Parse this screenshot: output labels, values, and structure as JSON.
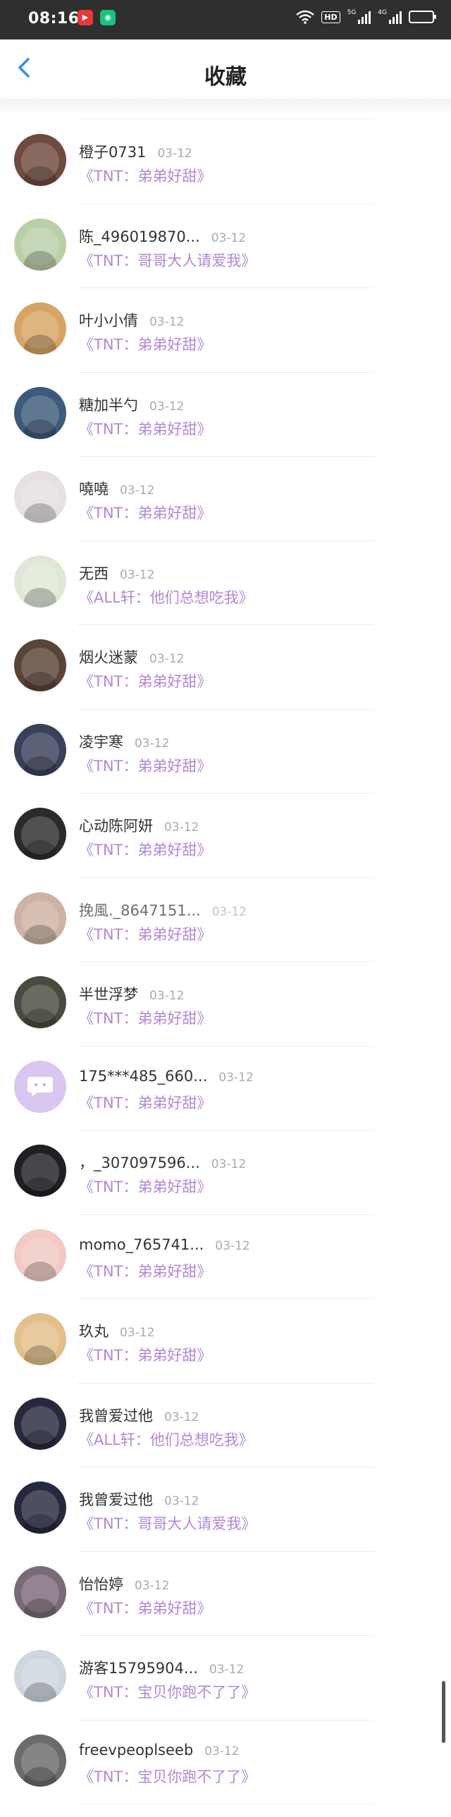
{
  "status_bar": {
    "time": "08:16",
    "hd_label": "HD",
    "signal1_label": "5G",
    "signal2_label": "4G"
  },
  "header": {
    "title": "收藏"
  },
  "colors": {
    "accent_blue": "#2f8fe6",
    "book_title": "#b287d9"
  },
  "items": [
    {
      "name": "橙子0731",
      "date": "03-12",
      "book": "《TNT：弟弟好甜》",
      "avatar_color": "#6f4a3e"
    },
    {
      "name": "陈_496019870...",
      "date": "03-12",
      "book": "《TNT：哥哥大人请爱我》",
      "avatar_color": "#b9cfa7"
    },
    {
      "name": "叶小小倩",
      "date": "03-12",
      "book": "《TNT：弟弟好甜》",
      "avatar_color": "#d7a465"
    },
    {
      "name": "糖加半勺",
      "date": "03-12",
      "book": "《TNT：弟弟好甜》",
      "avatar_color": "#3d5a7a"
    },
    {
      "name": "嘵嘵",
      "date": "03-12",
      "book": "《TNT：弟弟好甜》",
      "avatar_color": "#e6e0e0"
    },
    {
      "name": "无西",
      "date": "03-12",
      "book": "《ALL轩：他们总想吃我》",
      "avatar_color": "#dfe8d6"
    },
    {
      "name": "烟火迷蒙",
      "date": "03-12",
      "book": "《TNT：弟弟好甜》",
      "avatar_color": "#5a4438"
    },
    {
      "name": "凌宇寒",
      "date": "03-12",
      "book": "《TNT：弟弟好甜》",
      "avatar_color": "#3a3f5a"
    },
    {
      "name": "心动陈阿妍",
      "date": "03-12",
      "book": "《TNT：弟弟好甜》",
      "avatar_color": "#2b2b2b"
    },
    {
      "name": "挽風._8647151...",
      "date": "03-12",
      "book": "《TNT：弟弟好甜》",
      "avatar_color": "#cdb3a3"
    },
    {
      "name": "半世浮梦",
      "date": "03-12",
      "book": "《TNT：弟弟好甜》",
      "avatar_color": "#4b4a3e"
    },
    {
      "name": "175***485_660...",
      "date": "03-12",
      "book": "《TNT：弟弟好甜》",
      "avatar_color": "#d9c7f2"
    },
    {
      "name": "，_307097596...",
      "date": "03-12",
      "book": "《TNT：弟弟好甜》",
      "avatar_color": "#1f1f24"
    },
    {
      "name": "momo_765741...",
      "date": "03-12",
      "book": "《TNT：弟弟好甜》",
      "avatar_color": "#f2c9c4"
    },
    {
      "name": "玖丸",
      "date": "03-12",
      "book": "《TNT：弟弟好甜》",
      "avatar_color": "#e2c08a"
    },
    {
      "name": "我曾爱过他",
      "date": "03-12",
      "book": "《ALL轩：他们总想吃我》",
      "avatar_color": "#26283d"
    },
    {
      "name": "我曾爱过他",
      "date": "03-12",
      "book": "《TNT：哥哥大人请爱我》",
      "avatar_color": "#26283d"
    },
    {
      "name": "怡怡婷",
      "date": "03-12",
      "book": "《TNT：弟弟好甜》",
      "avatar_color": "#7a6a78"
    },
    {
      "name": "游客15795904...",
      "date": "03-12",
      "book": "《TNT：宝贝你跑不了了》",
      "avatar_color": "#cfd6df"
    },
    {
      "name": "freevpeoplseeb",
      "date": "03-12",
      "book": "《TNT：宝贝你跑不了了》",
      "avatar_color": "#6b6b6b"
    }
  ]
}
